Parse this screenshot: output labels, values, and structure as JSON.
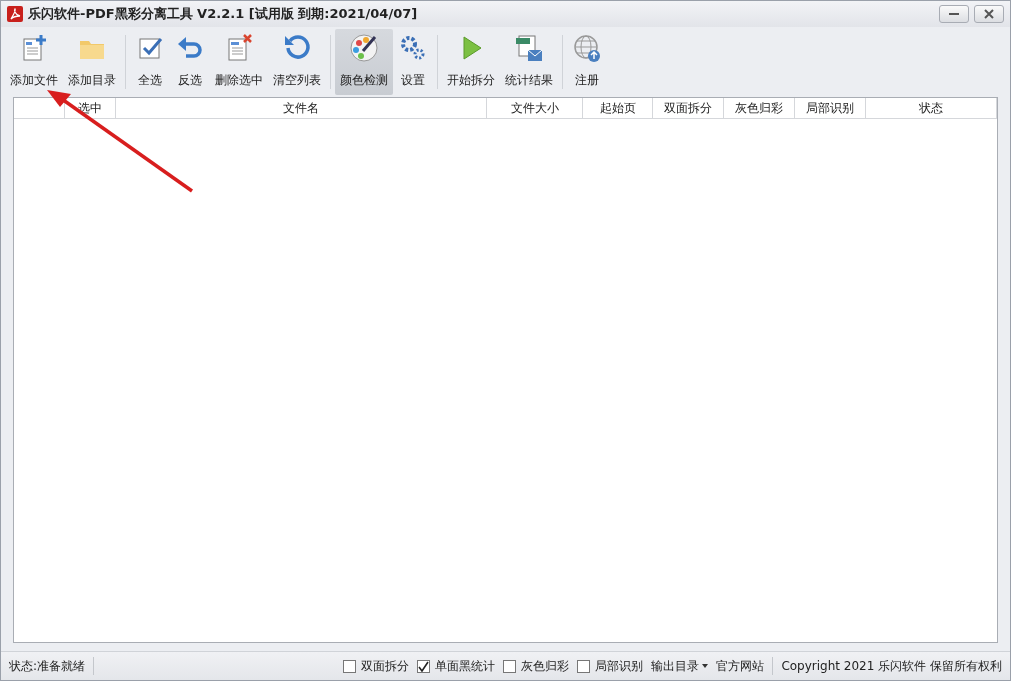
{
  "window": {
    "title": "乐闪软件-PDF黑彩分离工具 V2.2.1 [试用版 到期:2021/04/07]"
  },
  "toolbar_groups": [
    {
      "items": [
        {
          "kind": "add-file",
          "label": "添加文件",
          "selected": false
        },
        {
          "kind": "folder",
          "label": "添加目录",
          "selected": false
        }
      ]
    },
    {
      "items": [
        {
          "kind": "check",
          "label": "全选",
          "selected": false
        },
        {
          "kind": "undo",
          "label": "反选",
          "selected": false
        },
        {
          "kind": "delete",
          "label": "删除选中",
          "selected": false
        },
        {
          "kind": "refresh",
          "label": "清空列表",
          "selected": false
        }
      ]
    },
    {
      "items": [
        {
          "kind": "palette",
          "label": "颜色检测",
          "selected": true
        },
        {
          "kind": "gears",
          "label": "设置",
          "selected": false
        }
      ]
    },
    {
      "items": [
        {
          "kind": "play",
          "label": "开始拆分",
          "selected": false
        },
        {
          "kind": "xlsx",
          "label": "统计结果",
          "selected": false
        }
      ]
    },
    {
      "items": [
        {
          "kind": "globe",
          "label": "注册",
          "selected": false
        }
      ]
    }
  ],
  "table": {
    "columns": [
      "选中",
      "文件名",
      "文件大小",
      "起始页",
      "双面拆分",
      "灰色归彩",
      "局部识别",
      "状态"
    ]
  },
  "status_bar": {
    "status": "状态:准备就绪",
    "options": [
      {
        "label": "双面拆分",
        "checked": false
      },
      {
        "label": "单面黑统计",
        "checked": true
      },
      {
        "label": "灰色归彩",
        "checked": false
      },
      {
        "label": "局部识别",
        "checked": false
      }
    ],
    "output_menu": "输出目录",
    "website": "官方网站",
    "copyright": "Copyright 2021 乐闪软件 保留所有权利"
  }
}
